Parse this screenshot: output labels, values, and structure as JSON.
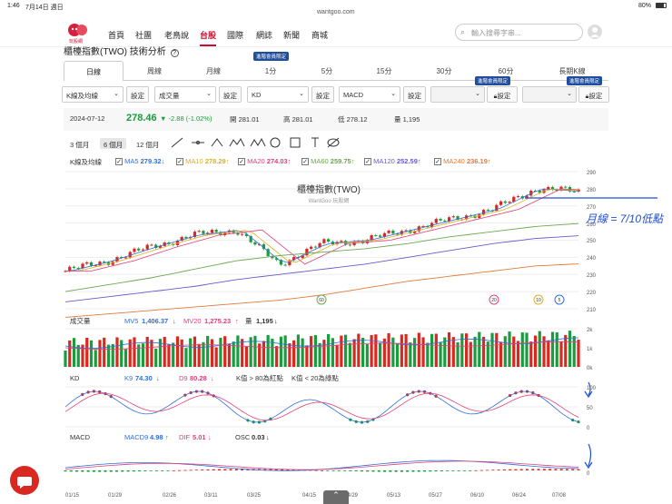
{
  "status": {
    "time": "1:46",
    "date": "7月14日 週日",
    "url": "wantgoo.com",
    "battery": "80%"
  },
  "logo": {
    "sub": "玩股網"
  },
  "nav": [
    "首頁",
    "社團",
    "老鳥說",
    "台股",
    "國際",
    "網誌",
    "新聞",
    "商城"
  ],
  "search": {
    "placeholder": "輸入搜尋字串..."
  },
  "page": {
    "title": "櫃檯指數(TWO) 技術分析"
  },
  "tabs": [
    "日線",
    "周線",
    "月線",
    "1分",
    "5分",
    "15分",
    "30分",
    "60分",
    "長期K線"
  ],
  "member_badge": "進階會員限定",
  "selectors": {
    "s1": "K線及均線",
    "s2": "成交量",
    "s3": "KD",
    "s4": "MACD",
    "btn": "設定"
  },
  "quote": {
    "date": "2024-07-12",
    "price": "278.46",
    "change": "-2.88 (-1.02%)",
    "open_label": "開",
    "open": "281.01",
    "high_label": "高",
    "high": "281.01",
    "low_label": "低",
    "low": "278.12",
    "vol_label": "量",
    "vol": "1,195"
  },
  "ranges": [
    "3 個月",
    "6 個月",
    "12 個月"
  ],
  "ma": {
    "label": "K線及均線",
    "items": [
      {
        "name": "MA5",
        "value": "279.32",
        "arrow": "↓",
        "color": "#2f6fd8"
      },
      {
        "name": "MA10",
        "value": "278.29",
        "arrow": "↑",
        "color": "#e0b020"
      },
      {
        "name": "MA20",
        "value": "274.03",
        "arrow": "↑",
        "color": "#e0407a"
      },
      {
        "name": "MA60",
        "value": "259.75",
        "arrow": "↑",
        "color": "#6aa84f"
      },
      {
        "name": "MA120",
        "value": "252.59",
        "arrow": "↑",
        "color": "#6a5acd"
      },
      {
        "name": "MA240",
        "value": "236.19",
        "arrow": "↑",
        "color": "#e07b39"
      }
    ]
  },
  "chart_title": "櫃檯指數(TWO)",
  "watermark": "WantGoo 玩股網",
  "price_ticks": [
    "290",
    "280",
    "270",
    "260",
    "250",
    "240",
    "230",
    "220",
    "210"
  ],
  "markers": [
    "60",
    "20",
    "10",
    "5"
  ],
  "volume": {
    "label": "成交量",
    "mv5_name": "MV5",
    "mv5": "1,406.37",
    "mv5_arrow": "↓",
    "mv20_name": "MV20",
    "mv20": "1,275.23",
    "mv20_arrow": "↑",
    "vol_name": "量",
    "vol": "1,195",
    "vol_arrow": "↓",
    "ticks": [
      "2k",
      "1k",
      "0k"
    ]
  },
  "kd": {
    "label": "KD",
    "k_name": "K9",
    "k": "74.30",
    "k_arrow": "↓",
    "d_name": "D9",
    "d": "80.28",
    "d_arrow": "↓",
    "rule1": "K值 > 80為紅點",
    "rule2": "K值 < 20為綠點",
    "ticks": [
      "100",
      "50",
      "0"
    ]
  },
  "macd": {
    "label": "MACD",
    "macd_name": "MACD9",
    "macd": "4.98",
    "macd_arrow": "↑",
    "dif_name": "DIF",
    "dif": "5.01",
    "dif_arrow": "↓",
    "osc_name": "OSC",
    "osc": "0.03",
    "osc_arrow": "↓",
    "ticks": [
      "0"
    ]
  },
  "xdates": [
    "01/15",
    "01/29",
    "02/26",
    "03/11",
    "03/25",
    "04/15",
    "04/29",
    "05/13",
    "05/27",
    "06/10",
    "06/24",
    "07/08"
  ],
  "annotation": "月線 = 7/10低點",
  "chart_data": {
    "type": "line",
    "title": "櫃檯指數(TWO)",
    "x": [
      "01/15",
      "01/29",
      "02/26",
      "03/11",
      "03/25",
      "04/15",
      "04/29",
      "05/13",
      "05/27",
      "06/10",
      "06/24",
      "07/08",
      "07/12"
    ],
    "series": [
      {
        "name": "",
        "values": [
          232,
          238,
          246,
          253,
          256,
          236,
          248,
          250,
          256,
          262,
          268,
          280,
          278.46
        ]
      },
      {
        "name": "MA60",
        "values": [
          220,
          224,
          228,
          233,
          238,
          241,
          243,
          245,
          248,
          252,
          255,
          258,
          259.75
        ]
      },
      {
        "name": "MA120",
        "values": [
          214,
          217,
          220,
          223,
          227,
          230,
          233,
          236,
          240,
          244,
          248,
          251,
          252.59
        ]
      },
      {
        "name": "MA240",
        "values": [
          205,
          207,
          209,
          211,
          213,
          215,
          218,
          222,
          226,
          229,
          232,
          235,
          236.19
        ]
      }
    ],
    "ylim": [
      210,
      290
    ]
  }
}
